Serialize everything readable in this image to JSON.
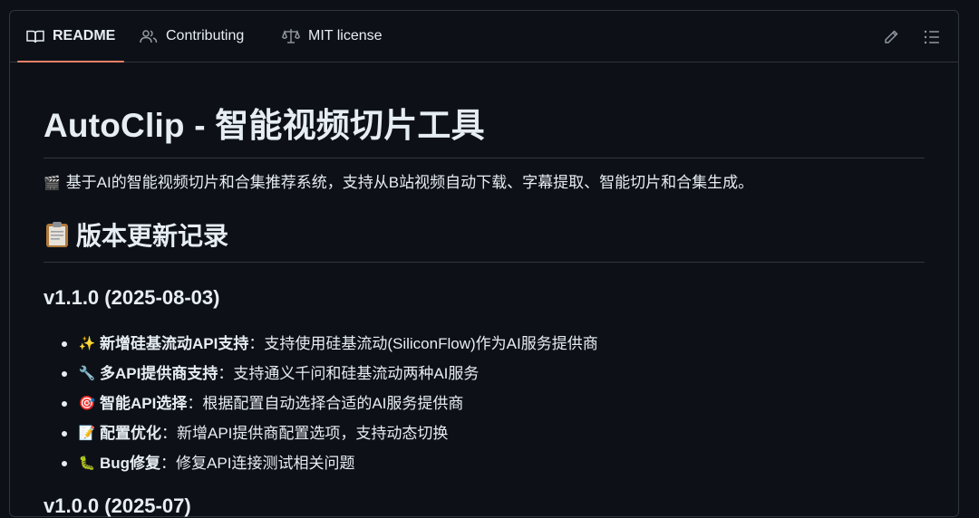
{
  "tabs": [
    {
      "label": "README",
      "icon": "book-icon",
      "active": true
    },
    {
      "label": "Contributing",
      "icon": "people-icon",
      "active": false
    },
    {
      "label": "MIT license",
      "icon": "law-icon",
      "active": false
    }
  ],
  "colors": {
    "accent": "#f78166",
    "background": "#0d1117",
    "border": "#30363d",
    "text": "#e6edf3"
  },
  "readme": {
    "title": "AutoClip - 智能视频切片工具",
    "intro_emoji": "🎬",
    "intro": "基于AI的智能视频切片和合集推荐系统，支持从B站视频自动下载、字幕提取、智能切片和合集生成。",
    "changelog_heading": "版本更新记录",
    "version_heading": "v1.1.0 (2025-08-03)",
    "items": [
      {
        "emoji": "✨",
        "bold": "新增硅基流动API支持",
        "sep": "：",
        "text": "支持使用硅基流动(SiliconFlow)作为AI服务提供商"
      },
      {
        "emoji": "🔧",
        "bold": "多API提供商支持",
        "sep": "：",
        "text": "支持通义千问和硅基流动两种AI服务"
      },
      {
        "emoji": "🎯",
        "bold": "智能API选择",
        "sep": "：",
        "text": "根据配置自动选择合适的AI服务提供商"
      },
      {
        "emoji": "📝",
        "bold": "配置优化",
        "sep": "：",
        "text": "新增API提供商配置选项，支持动态切换"
      },
      {
        "emoji": "🐛",
        "bold": "Bug修复",
        "sep": "：",
        "text": "修复API连接测试相关问题"
      }
    ],
    "next_version_heading": "v1.0.0 (2025-07)"
  }
}
